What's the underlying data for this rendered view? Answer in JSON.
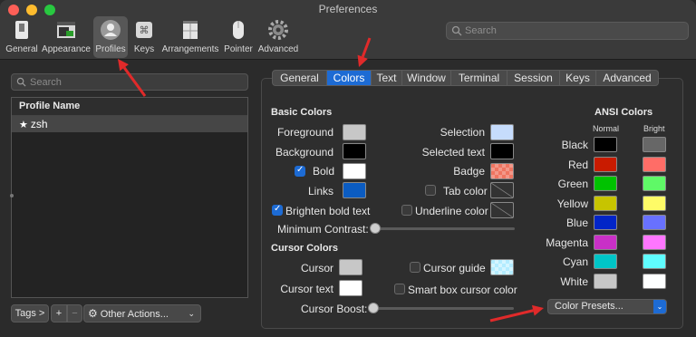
{
  "window": {
    "title": "Preferences"
  },
  "toolbar": {
    "items": [
      {
        "label": "General",
        "icon": "general-icon"
      },
      {
        "label": "Appearance",
        "icon": "appearance-icon"
      },
      {
        "label": "Profiles",
        "icon": "profiles-icon",
        "selected": true
      },
      {
        "label": "Keys",
        "icon": "keys-icon"
      },
      {
        "label": "Arrangements",
        "icon": "arrangements-icon"
      },
      {
        "label": "Pointer",
        "icon": "pointer-icon"
      },
      {
        "label": "Advanced",
        "icon": "advanced-icon"
      }
    ],
    "search_placeholder": "Search"
  },
  "profiles": {
    "search_placeholder": "Search",
    "header": "Profile Name",
    "rows": [
      {
        "name": "zsh",
        "default": true
      }
    ],
    "tags_label": "Tags >",
    "plus_label": "+",
    "minus_label": "−",
    "other_actions_label": "Other Actions..."
  },
  "tabs": [
    "General",
    "Colors",
    "Text",
    "Window",
    "Terminal",
    "Session",
    "Keys",
    "Advanced"
  ],
  "active_tab": "Colors",
  "basic_colors": {
    "title": "Basic Colors",
    "foreground": {
      "label": "Foreground",
      "color": "#c7c7c7"
    },
    "background": {
      "label": "Background",
      "color": "#000000"
    },
    "bold": {
      "label": "Bold",
      "color": "#ffffff",
      "checked": true
    },
    "links": {
      "label": "Links",
      "color": "#0b5cc2"
    },
    "brighten": {
      "label": "Brighten bold text",
      "checked": true
    },
    "min_contrast": {
      "label": "Minimum Contrast:",
      "value": 0
    },
    "selection": {
      "label": "Selection",
      "color": "#c6dcfc"
    },
    "selected_text": {
      "label": "Selected text",
      "color": "#000000"
    },
    "badge": {
      "label": "Badge",
      "color": "#ef7561"
    },
    "tab_color": {
      "label": "Tab color",
      "checked": false
    },
    "underline_color": {
      "label": "Underline color",
      "checked": false
    }
  },
  "cursor_colors": {
    "title": "Cursor Colors",
    "cursor": {
      "label": "Cursor",
      "color": "#c7c7c7"
    },
    "cursor_text": {
      "label": "Cursor text",
      "color": "#ffffff"
    },
    "cursor_guide": {
      "label": "Cursor guide",
      "checked": false,
      "color": "#b3ecff"
    },
    "smart_box": {
      "label": "Smart box cursor color",
      "checked": false
    },
    "boost": {
      "label": "Cursor Boost:",
      "value": 0
    }
  },
  "ansi": {
    "title": "ANSI Colors",
    "normal_label": "Normal",
    "bright_label": "Bright",
    "rows": [
      {
        "name": "Black",
        "normal": "#000000",
        "bright": "#676767"
      },
      {
        "name": "Red",
        "normal": "#c91b00",
        "bright": "#ff6d67"
      },
      {
        "name": "Green",
        "normal": "#00c200",
        "bright": "#5ff967"
      },
      {
        "name": "Yellow",
        "normal": "#c7c400",
        "bright": "#fefb67"
      },
      {
        "name": "Blue",
        "normal": "#0225c7",
        "bright": "#6871ff"
      },
      {
        "name": "Magenta",
        "normal": "#c930c7",
        "bright": "#ff76ff"
      },
      {
        "name": "Cyan",
        "normal": "#00c5c7",
        "bright": "#5ffdff"
      },
      {
        "name": "White",
        "normal": "#c7c7c7",
        "bright": "#feffff"
      }
    ]
  },
  "presets_label": "Color Presets...",
  "accent": "#1d6bd4",
  "annotation_color": "#e02a2a"
}
